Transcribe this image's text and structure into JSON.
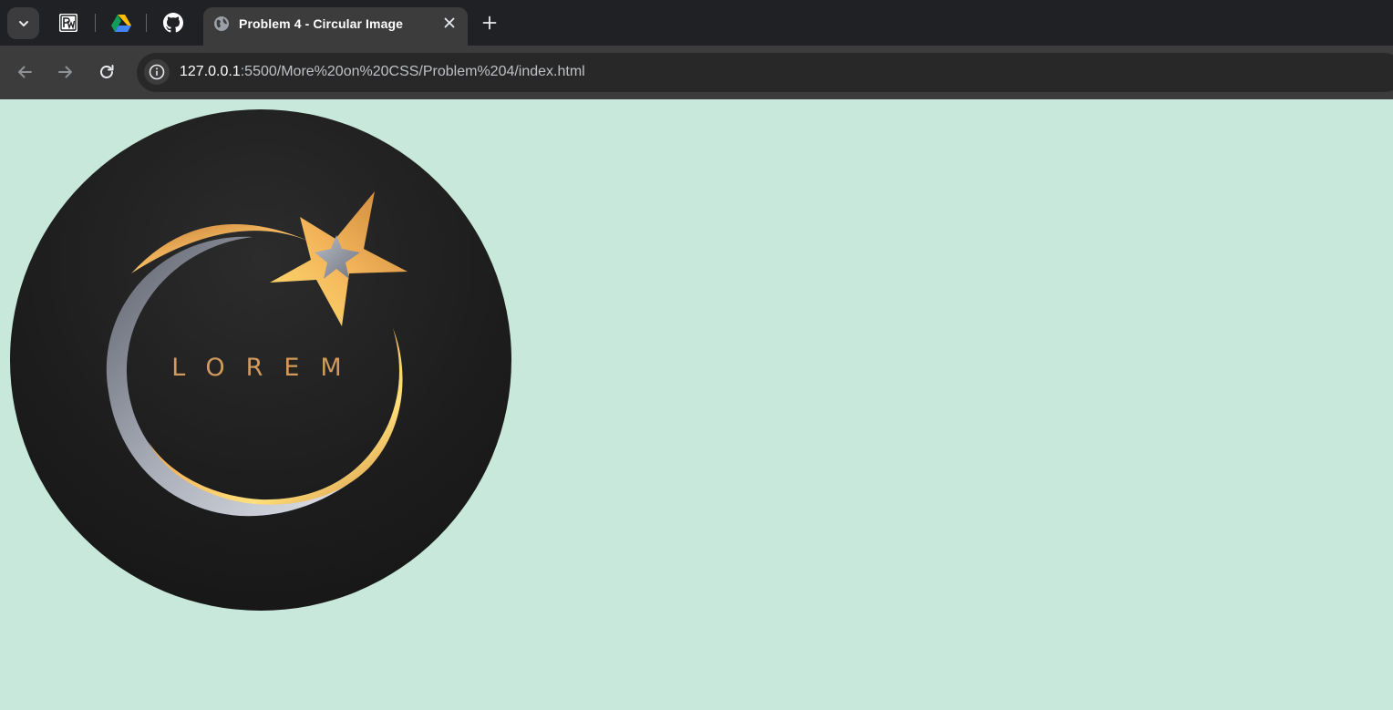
{
  "browser": {
    "active_tab": {
      "title": "Problem 4 - Circular Image",
      "favicon": "globe-icon"
    },
    "pinned_tabs": [
      {
        "icon": "pw-logo-icon"
      },
      {
        "icon": "google-drive-icon"
      },
      {
        "icon": "github-icon"
      }
    ],
    "address_bar": {
      "url_host": "127.0.0.1",
      "url_rest": ":5500/More%20on%20CSS/Problem%204/index.html"
    }
  },
  "page": {
    "background_color": "#c8e8dc",
    "image": {
      "shape": "circle",
      "logo_text": "LOREM",
      "colors": {
        "gold": "#f4b860",
        "silver": "#a8adb8",
        "dark": "#1d1d1d"
      }
    }
  }
}
